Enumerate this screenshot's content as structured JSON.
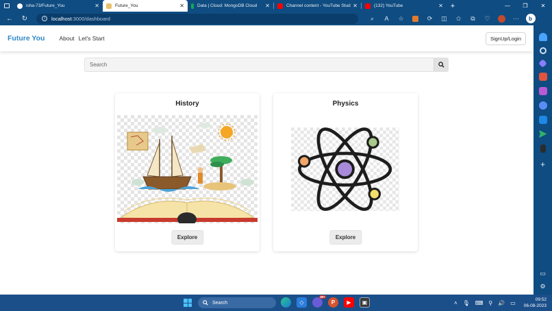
{
  "browser": {
    "tabs": [
      {
        "title": "isha-73/Future_You",
        "active": false,
        "icon": "github-icon",
        "color": "#1b1f23"
      },
      {
        "title": "Future_You",
        "active": true,
        "icon": "react-icon",
        "color": "#e8c26a"
      },
      {
        "title": "Data | Cloud: MongoDB Cloud",
        "active": false,
        "icon": "mongodb-icon",
        "color": "#13aa52"
      },
      {
        "title": "Channel content - YouTube Studio",
        "active": false,
        "icon": "youtube-icon",
        "color": "#ff0000"
      },
      {
        "title": "(132) YouTube",
        "active": false,
        "icon": "youtube-icon",
        "color": "#ff0000"
      }
    ],
    "url_host": "localhost",
    "url_path": ":3000/dashboard"
  },
  "app": {
    "brand": "Future You",
    "nav": [
      "About",
      "Let's Start"
    ],
    "auth_button": "SignUp/Login",
    "search_placeholder": "Search",
    "brand_color": "#2e88c7"
  },
  "cards": [
    {
      "title": "History",
      "button": "Explore"
    },
    {
      "title": "Physics",
      "button": "Explore"
    }
  ],
  "taskbar": {
    "search": "Search",
    "badge": "99+",
    "time": "09:52",
    "date": "06-08-2023"
  }
}
